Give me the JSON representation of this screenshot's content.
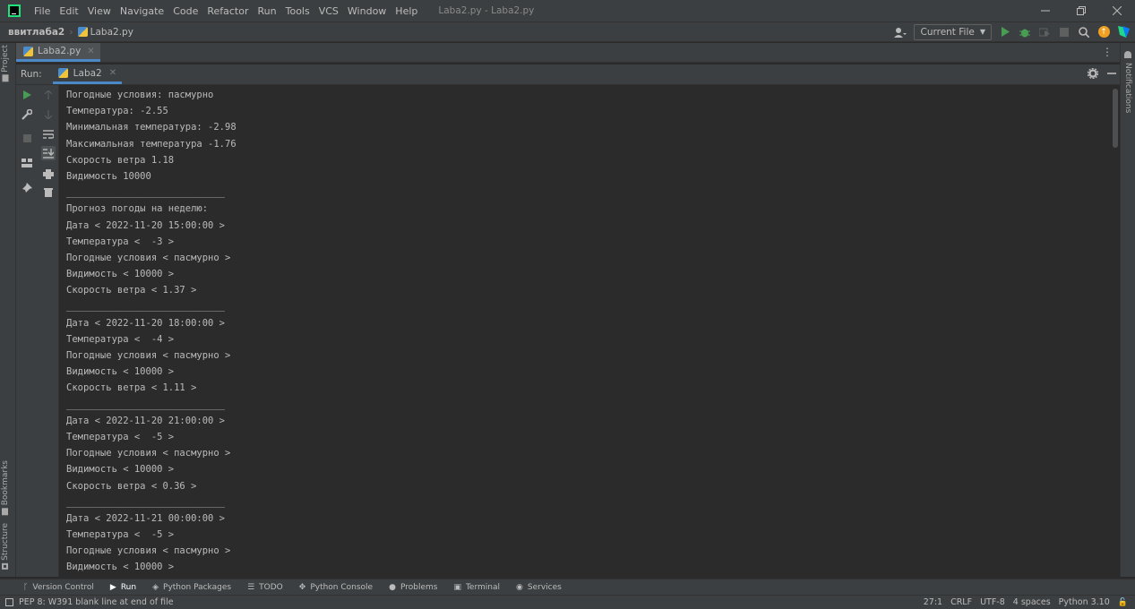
{
  "menubar": {
    "items": [
      "File",
      "Edit",
      "View",
      "Navigate",
      "Code",
      "Refactor",
      "Run",
      "Tools",
      "VCS",
      "Window",
      "Help"
    ],
    "window_title": "Laba2.py - Laba2.py"
  },
  "navbar": {
    "project": "ввитлаба2",
    "file": "Laba2.py",
    "run_config": "Current File"
  },
  "left_strip": {
    "project_label": "Project",
    "bookmarks_label": "Bookmarks",
    "structure_label": "Structure"
  },
  "right_strip": {
    "notifications_label": "Notifications"
  },
  "editor": {
    "tab_label": "Laba2.py"
  },
  "run_window": {
    "label": "Run:",
    "tab_label": "Laba2"
  },
  "console": {
    "lines": [
      "Погодные условия: пасмурно",
      "Температура: -2.55",
      "Минимальная температура: -2.98",
      "Максимальная температура -1.76",
      "Скорость ветра 1.18",
      "Видимость 10000",
      "____________________________",
      "Прогноз погоды на неделю:",
      "Дата < 2022-11-20 15:00:00 >",
      "Температура <  -3 >",
      "Погодные условия < пасмурно >",
      "Видимость < 10000 >",
      "Скорость ветра < 1.37 >",
      "____________________________",
      "Дата < 2022-11-20 18:00:00 >",
      "Температура <  -4 >",
      "Погодные условия < пасмурно >",
      "Видимость < 10000 >",
      "Скорость ветра < 1.11 >",
      "____________________________",
      "Дата < 2022-11-20 21:00:00 >",
      "Температура <  -5 >",
      "Погодные условия < пасмурно >",
      "Видимость < 10000 >",
      "Скорость ветра < 0.36 >",
      "____________________________",
      "Дата < 2022-11-21 00:00:00 >",
      "Температура <  -5 >",
      "Погодные условия < пасмурно >",
      "Видимость < 10000 >"
    ]
  },
  "bottom_bar": {
    "tabs": [
      "Version Control",
      "Run",
      "Python Packages",
      "TODO",
      "Python Console",
      "Problems",
      "Terminal",
      "Services"
    ]
  },
  "statusbar": {
    "message": "PEP 8: W391 blank line at end of file",
    "position": "27:1",
    "line_separator": "CRLF",
    "encoding": "UTF-8",
    "indent": "4 spaces",
    "interpreter": "Python 3.10"
  },
  "colors": {
    "accent": "#4a88c7",
    "run_green": "#499c54",
    "bg_dark": "#2b2b2b",
    "bg_panel": "#3c3f41"
  }
}
